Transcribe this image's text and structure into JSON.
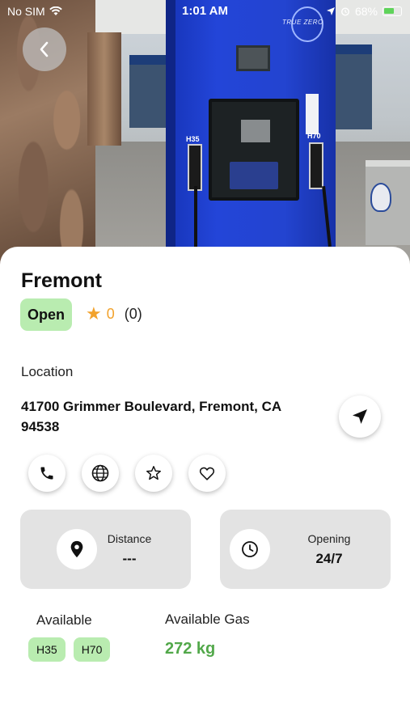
{
  "status_bar": {
    "carrier": "No SIM",
    "time": "1:01 AM",
    "battery": "68%",
    "battery_level": 0.68
  },
  "hero": {
    "pump_label_left": "H35",
    "pump_label_right": "H70",
    "brand": "TRUE ZERO"
  },
  "station": {
    "name": "Fremont",
    "status": "Open",
    "rating": "0",
    "review_count": "(0)"
  },
  "location": {
    "label": "Location",
    "address": "41700 Grimmer Boulevard, Fremont, CA 94538"
  },
  "info_cards": {
    "distance": {
      "label": "Distance",
      "value": "---"
    },
    "opening": {
      "label": "Opening",
      "value": "24/7"
    }
  },
  "availability": {
    "label": "Available",
    "tags": [
      "H35",
      "H70"
    ]
  },
  "available_gas": {
    "label": "Available Gas",
    "value": "272 kg"
  },
  "colors": {
    "accent_green": "#52a84a",
    "badge_green": "#b9ecb0",
    "star_orange": "#f2a22c",
    "pump_blue": "#2345d8"
  },
  "icons": [
    "back-icon",
    "navigate-icon",
    "phone-icon",
    "globe-icon",
    "star-outline-icon",
    "heart-icon",
    "location-pin-icon",
    "clock-icon"
  ]
}
